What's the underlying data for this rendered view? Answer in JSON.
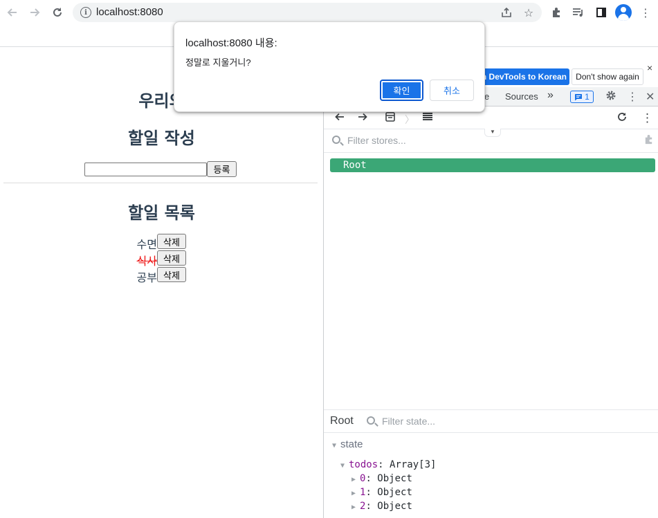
{
  "browser": {
    "url": "localhost:8080",
    "icons": [
      "back-icon",
      "forward-icon",
      "reload-icon",
      "info-icon",
      "share-icon",
      "star-icon",
      "extensions-icon",
      "media-icon",
      "sidepanel-icon",
      "avatar",
      "menu-icon"
    ]
  },
  "page": {
    "title": "우리의 ",
    "write_heading": "할일 작성",
    "input_value": "",
    "add_button": "등록",
    "list_heading": "할일 목록",
    "todos": [
      {
        "text": "수면",
        "done": false,
        "delete_label": "삭제"
      },
      {
        "text": "식사",
        "done": true,
        "delete_label": "삭제"
      },
      {
        "text": "공부",
        "done": false,
        "delete_label": "삭제"
      }
    ]
  },
  "devtools": {
    "banner": {
      "switch_label": "ch DevTools to Korean",
      "dont_show_label": "Don't show again",
      "close": "×"
    },
    "tabs": {
      "partial_tab": "e",
      "sources": "Sources",
      "more": "»",
      "messages_count": "1"
    },
    "vue": {
      "filter_stores_placeholder": "Filter stores...",
      "root_label": "Root",
      "state_panel_title": "Root",
      "filter_state_placeholder": "Filter state...",
      "state_section": "state",
      "todos_key": "todos",
      "todos_value": "Array[3]",
      "items": [
        {
          "index": "0",
          "value": "Object"
        },
        {
          "index": "1",
          "value": "Object"
        },
        {
          "index": "2",
          "value": "Object"
        }
      ]
    }
  },
  "dialog": {
    "title": "localhost:8080 내용:",
    "message": "정말로 지울거니?",
    "ok_label": "확인",
    "cancel_label": "취소"
  },
  "colors": {
    "accent": "#1a73e8",
    "root_pill": "#3ba776",
    "done_text": "#e11111",
    "heading": "#2c3e50"
  }
}
